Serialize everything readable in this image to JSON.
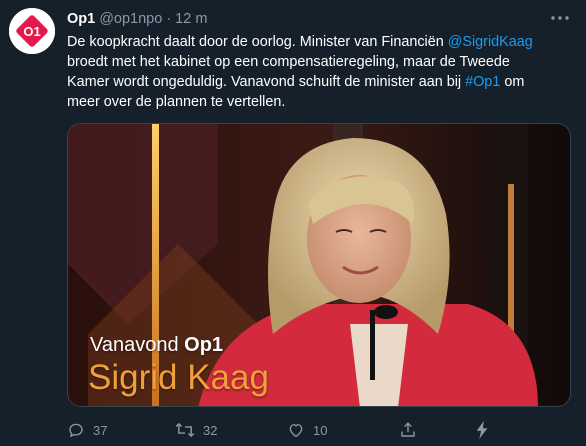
{
  "tweet": {
    "author": {
      "name": "Op1",
      "handle": "@op1npo",
      "separator": "·",
      "time": "12 m"
    },
    "text": {
      "line1": "De koopkracht daalt door de oorlog. Minister van Financiën ",
      "mention": "@SigridKaag",
      "line2": "broedt met het kabinet op een compensatieregeling, maar de Tweede",
      "line3_before": "Kamer wordt ongeduldig. Vanavond schuift de minister aan bij ",
      "hashtag": "#Op1",
      "line3_after": " om",
      "line4": "meer over de plannen te vertellen."
    },
    "media": {
      "overlay_prefix": "Vanavond ",
      "overlay_brand": "Op1",
      "overlay_name": "Sigrid Kaag",
      "badge_text": "O1"
    },
    "actions": {
      "reply_count": "37",
      "retweet_count": "32",
      "like_count": "10"
    }
  },
  "icons": {
    "more": "more-icon",
    "reply": "reply-icon",
    "retweet": "retweet-icon",
    "like": "like-icon",
    "share": "share-icon",
    "analytics": "analytics-icon"
  },
  "colors": {
    "background": "#15202b",
    "text": "#ffffff",
    "muted": "#8b98a5",
    "link": "#1d9bf0",
    "brand_red": "#e3194b",
    "caption_orange": "#f0a03a"
  }
}
